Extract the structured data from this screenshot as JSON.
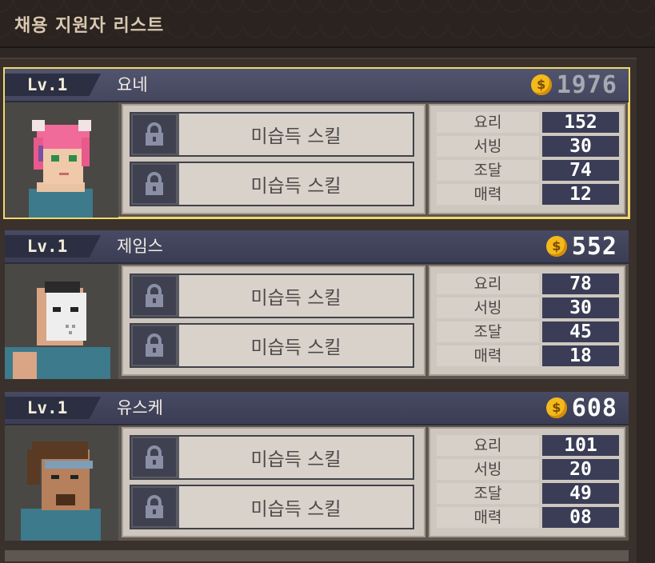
{
  "header": {
    "title": "채용 지원자 리스트"
  },
  "candidates": [
    {
      "level": "Lv.1",
      "name": "요네",
      "price": "1976",
      "affordable": false,
      "selected": true,
      "skills": [
        "미습득 스킬",
        "미습득 스킬"
      ],
      "stats": [
        {
          "label": "요리",
          "value": "152"
        },
        {
          "label": "서빙",
          "value": "30"
        },
        {
          "label": "조달",
          "value": "74"
        },
        {
          "label": "매력",
          "value": "12"
        }
      ]
    },
    {
      "level": "Lv.1",
      "name": "제임스",
      "price": "552",
      "affordable": true,
      "selected": false,
      "skills": [
        "미습득 스킬",
        "미습득 스킬"
      ],
      "stats": [
        {
          "label": "요리",
          "value": "78"
        },
        {
          "label": "서빙",
          "value": "30"
        },
        {
          "label": "조달",
          "value": "45"
        },
        {
          "label": "매력",
          "value": "18"
        }
      ]
    },
    {
      "level": "Lv.1",
      "name": "유스케",
      "price": "608",
      "affordable": true,
      "selected": false,
      "skills": [
        "미습득 스킬",
        "미습득 스킬"
      ],
      "stats": [
        {
          "label": "요리",
          "value": "101"
        },
        {
          "label": "서빙",
          "value": "20"
        },
        {
          "label": "조달",
          "value": "49"
        },
        {
          "label": "매력",
          "value": "08"
        }
      ]
    }
  ],
  "icons": {
    "coin": "coin-icon",
    "lock": "lock-icon"
  },
  "colors": {
    "selected_border": "#f3d86b",
    "coin": "#f4b91b",
    "stat_value_bg": "#3a3d55"
  }
}
